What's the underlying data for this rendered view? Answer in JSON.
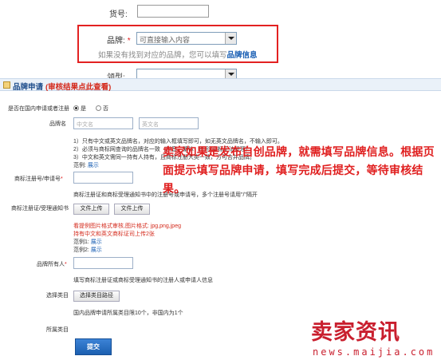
{
  "top": {
    "item_no_label": "货号:",
    "brand_label": "品牌:",
    "required_mark": "*",
    "brand_placeholder": "可直接输入内容",
    "brand_hint": "如果没有找到对应的品牌，您可以填写",
    "brand_info_link": "品牌信息",
    "spec_label": "领型:"
  },
  "section": {
    "title": "品牌申请",
    "subtitle": "(审核结果点此查看)"
  },
  "form": {
    "domestic_label": "是否在国内申请或者注册",
    "yes": "是",
    "no": "否",
    "brand_name_label": "品牌名",
    "cn_placeholder": "中文名",
    "en_placeholder": "英文名",
    "rules": [
      "1）只有中文或英文品牌名，对应的输入框填写即可，如无英文品牌名，不输入即可。",
      "2）必须与商标网查询的品牌名一致（拼音，繁体，图形/商标无法授理）",
      "3）中文和英文需同一持有人持有，且商标注册大类一致，方可合并品牌。"
    ],
    "example_label": "范例:",
    "show_link": "展示",
    "reg_no_label": "商标注册号/申请号",
    "reg_no_hint": "商标注册证和商标受理通知书中的注册号或申请号，多个注册号请用\"/\"隔开",
    "cert_label": "商标注册证/受理通知书",
    "upload_btn": "文件上传",
    "upload_note_1": "看提例图片格式审核,图片格式: jpg,png,jpeg",
    "upload_note_2": "持有中文和英文商标证司上传2张",
    "example_1": "范例1:",
    "example_2": "范例2:",
    "owner_label": "品牌所有人",
    "owner_hint": "填写商标注册证或商标受理通知书的注册人或申请人信息",
    "category_label": "选择类目",
    "category_btn": "选择类目路径",
    "category_hint": "国内品牌申请所属类目限10个，非国内为1个",
    "belong_label": "所属类目",
    "submit": "提交"
  },
  "overlay_text": "卖家如果是发布自创品牌，就需填写品牌信息。根据页面提示填写品牌申请，填写完成后提交，等待审核结果。",
  "watermark": {
    "brand": "卖家资讯",
    "url": "news.maijia.com"
  },
  "colors": {
    "highlight_border": "#e32121",
    "overlay_text": "#e02020",
    "link": "#1a5fb4",
    "submit_bg": "#1b5fb0",
    "watermark": "#c91f2e"
  }
}
